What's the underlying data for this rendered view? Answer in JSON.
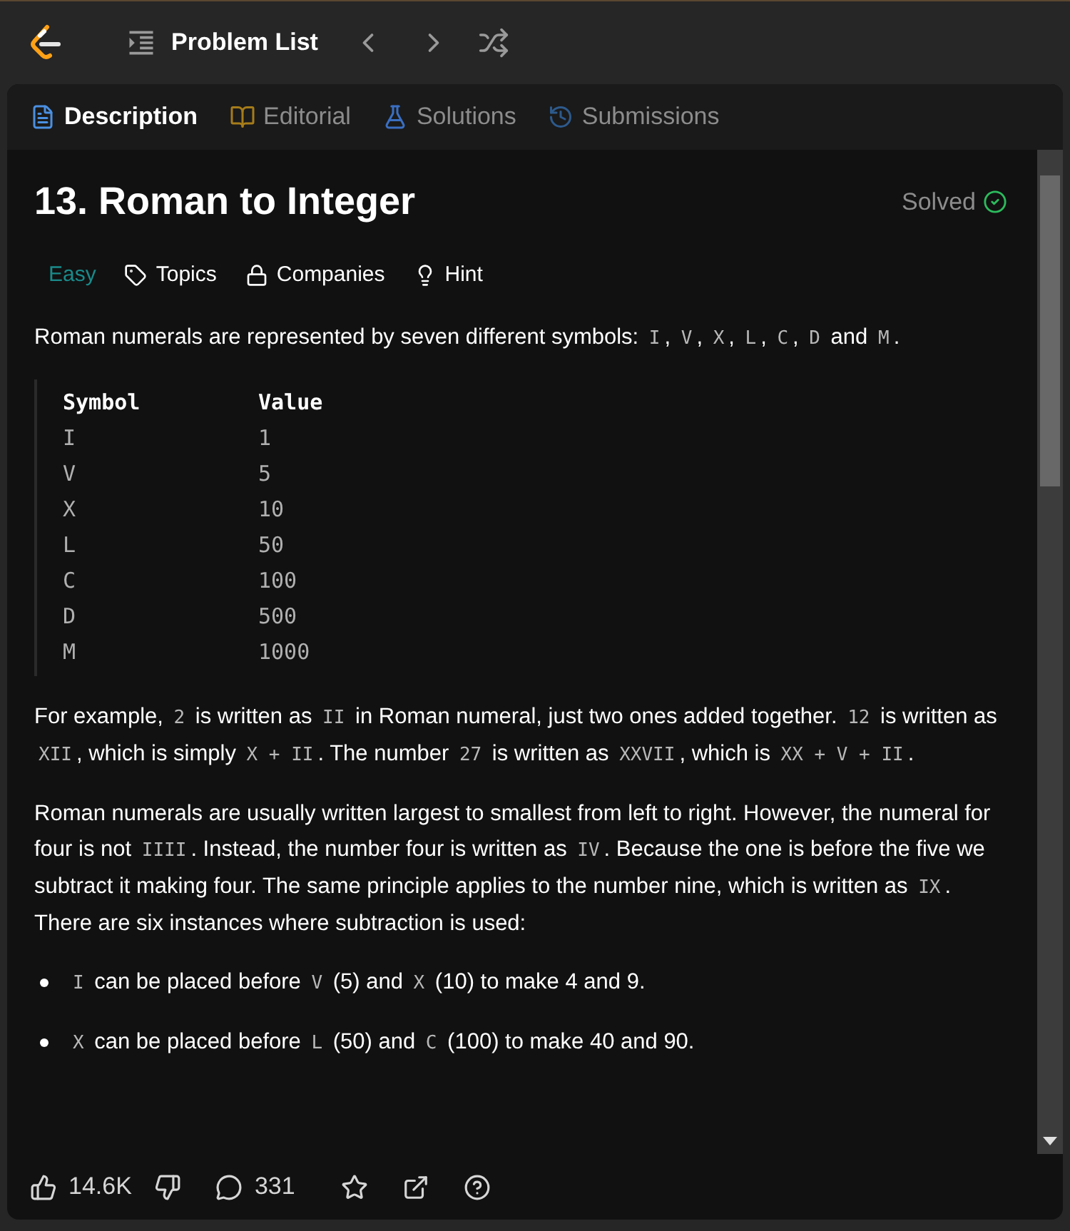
{
  "top_bar": {
    "title": "Problem List"
  },
  "tabs": [
    {
      "label": "Description",
      "kind": "description",
      "selected": true
    },
    {
      "label": "Editorial",
      "kind": "editorial",
      "selected": false
    },
    {
      "label": "Solutions",
      "kind": "solutions",
      "selected": false
    },
    {
      "label": "Submissions",
      "kind": "submissions",
      "selected": false
    }
  ],
  "problem": {
    "title": "13. Roman to Integer",
    "status": "Solved",
    "difficulty": "Easy",
    "tags": [
      {
        "label": "Topics",
        "kind": "topics"
      },
      {
        "label": "Companies",
        "kind": "companies"
      },
      {
        "label": "Hint",
        "kind": "hint"
      }
    ]
  },
  "content": [
    {
      "kind": "paragraph",
      "segments": [
        {
          "text": "Roman numerals are represented by seven different symbols: ",
          "code": false
        },
        {
          "text": "I",
          "code": true
        },
        {
          "text": ", ",
          "code": false
        },
        {
          "text": "V",
          "code": true
        },
        {
          "text": ", ",
          "code": false
        },
        {
          "text": "X",
          "code": true
        },
        {
          "text": ", ",
          "code": false
        },
        {
          "text": "L",
          "code": true
        },
        {
          "text": ", ",
          "code": false
        },
        {
          "text": "C",
          "code": true
        },
        {
          "text": ", ",
          "code": false
        },
        {
          "text": "D",
          "code": true
        },
        {
          "text": " and ",
          "code": false
        },
        {
          "text": "M",
          "code": true
        },
        {
          "text": ".",
          "code": false
        }
      ]
    },
    {
      "kind": "table",
      "columns": [
        "Symbol",
        "Value"
      ],
      "rows": [
        [
          "I",
          "1"
        ],
        [
          "V",
          "5"
        ],
        [
          "X",
          "10"
        ],
        [
          "L",
          "50"
        ],
        [
          "C",
          "100"
        ],
        [
          "D",
          "500"
        ],
        [
          "M",
          "1000"
        ]
      ]
    },
    {
      "kind": "paragraph",
      "segments": [
        {
          "text": "For example, ",
          "code": false
        },
        {
          "text": "2",
          "code": true
        },
        {
          "text": " is written as ",
          "code": false
        },
        {
          "text": "II",
          "code": true
        },
        {
          "text": " in Roman numeral, just two ones added together. ",
          "code": false
        },
        {
          "text": "12",
          "code": true
        },
        {
          "text": " is written as ",
          "code": false
        },
        {
          "text": "XII",
          "code": true
        },
        {
          "text": ", which is simply ",
          "code": false
        },
        {
          "text": "X + II",
          "code": true
        },
        {
          "text": ". The number ",
          "code": false
        },
        {
          "text": "27",
          "code": true
        },
        {
          "text": " is written as ",
          "code": false
        },
        {
          "text": "XXVII",
          "code": true
        },
        {
          "text": ", which is ",
          "code": false
        },
        {
          "text": "XX + V + II",
          "code": true
        },
        {
          "text": ".",
          "code": false
        }
      ]
    },
    {
      "kind": "paragraph",
      "segments": [
        {
          "text": "Roman numerals are usually written largest to smallest from left to right. However, the numeral for four is not ",
          "code": false
        },
        {
          "text": "IIII",
          "code": true
        },
        {
          "text": ". Instead, the number four is written as ",
          "code": false
        },
        {
          "text": "IV",
          "code": true
        },
        {
          "text": ". Because the one is before the five we subtract it making four. The same principle applies to the number nine, which is written as ",
          "code": false
        },
        {
          "text": "IX",
          "code": true
        },
        {
          "text": ". There are six instances where subtraction is used:",
          "code": false
        }
      ]
    },
    {
      "kind": "list",
      "items": [
        {
          "segments": [
            {
              "text": "I",
              "code": true
            },
            {
              "text": " can be placed before ",
              "code": false
            },
            {
              "text": "V",
              "code": true
            },
            {
              "text": " (5) and ",
              "code": false
            },
            {
              "text": "X",
              "code": true
            },
            {
              "text": " (10) to make 4 and 9.",
              "code": false
            }
          ]
        },
        {
          "segments": [
            {
              "text": "X",
              "code": true
            },
            {
              "text": " can be placed before ",
              "code": false
            },
            {
              "text": "L",
              "code": true
            },
            {
              "text": " (50) and ",
              "code": false
            },
            {
              "text": "C",
              "code": true
            },
            {
              "text": " (100) to make 40 and 90.",
              "code": false
            }
          ]
        }
      ]
    }
  ],
  "footer": {
    "likes": "14.6K",
    "comments": "331"
  }
}
